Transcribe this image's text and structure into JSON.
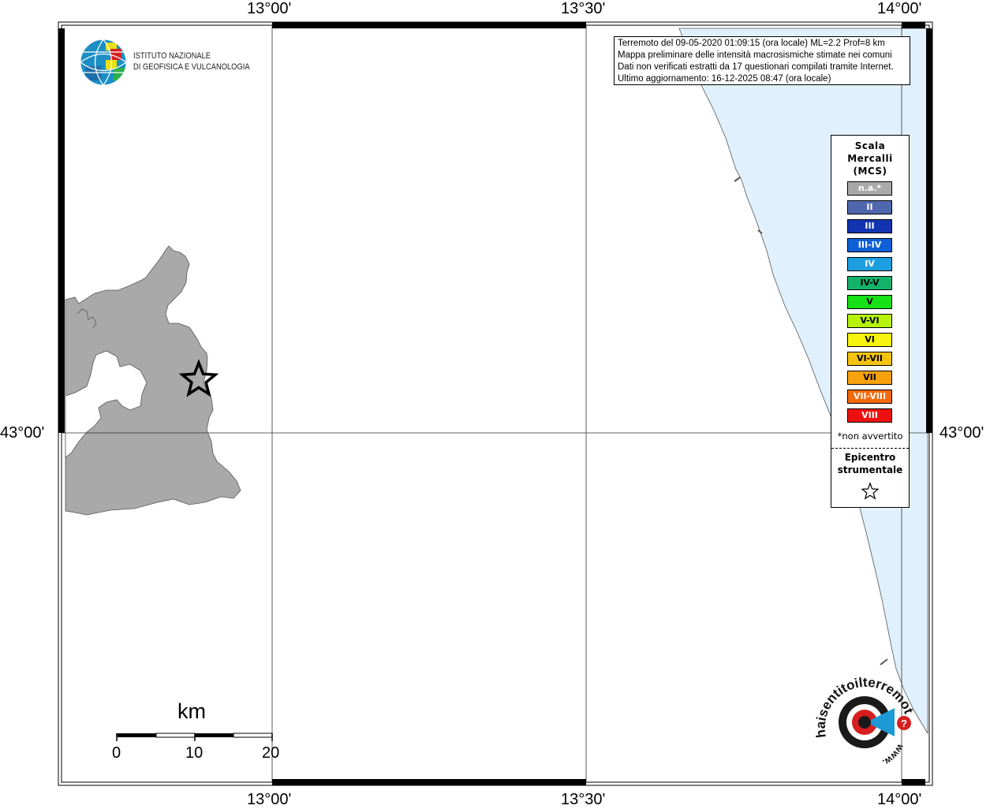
{
  "map": {
    "lon_labels": {
      "left": "13°00'",
      "middle": "13°30'",
      "right": "14°00'"
    },
    "lat_labels": {
      "value": "43°00'"
    },
    "sea_color": "#e0f1fd",
    "land_color": "#a9a9a9"
  },
  "info_box": {
    "line1": "Terremoto del 09-05-2020 01:09:15 (ora locale) ML=2.2 Prof=8 km",
    "line2": "Mappa preliminare delle intensità macrosismiche stimate nei comuni",
    "line3": "Dati non verificati estratti da 17 questionari compilati tramite Internet.",
    "line4": "Ultimo aggiornamento: 16-12-2025 08:47 (ora locale)"
  },
  "institute": {
    "line1": "ISTITUTO NAZIONALE",
    "line2": "DI GEOFISICA E VULCANOLOGIA"
  },
  "legend": {
    "title_line1": "Scala",
    "title_line2": "Mercalli",
    "title_line3": "(MCS)",
    "items": [
      {
        "label": "n.a.*",
        "color": "#a9a9a9"
      },
      {
        "label": "II",
        "color": "#4f67ad"
      },
      {
        "label": "III",
        "color": "#1234b0"
      },
      {
        "label": "III-IV",
        "color": "#1060d8"
      },
      {
        "label": "IV",
        "color": "#1c9fe0"
      },
      {
        "label": "IV-V",
        "color": "#12b26a"
      },
      {
        "label": "V",
        "color": "#16e016"
      },
      {
        "label": "V-VI",
        "color": "#b6f20a"
      },
      {
        "label": "VI",
        "color": "#f6f40c"
      },
      {
        "label": "VI-VII",
        "color": "#f4c30d"
      },
      {
        "label": "VII",
        "color": "#f7a20c"
      },
      {
        "label": "VII-VIII",
        "color": "#f46a0a"
      },
      {
        "label": "VIII",
        "color": "#ee1010"
      }
    ],
    "note": "*non avvertito",
    "epicenter_line1": "Epicentro",
    "epicenter_line2": "strumentale"
  },
  "scale_bar": {
    "unit": "km",
    "ticks": [
      "0",
      "10",
      "20"
    ]
  },
  "site_logo": {
    "text_main": "haisentitoilterremoto.it",
    "text_www": "www.",
    "question_mark": "?"
  }
}
